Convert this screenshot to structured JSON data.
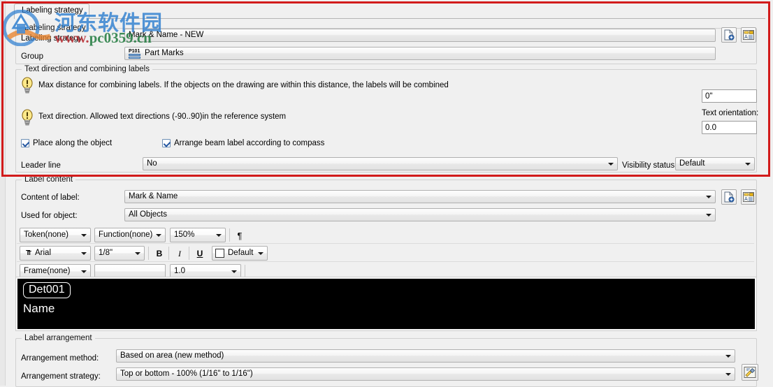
{
  "window": {
    "tab_label": "Labeling strategy",
    "accent_highlight": "#d21b1b"
  },
  "watermark": {
    "site_name": "河东软件园",
    "url_prefix": "www.",
    "url_rest": "pc0359.cn"
  },
  "strategy": {
    "group_label": "Labeling strategy",
    "name_label": "Labeling strategy",
    "name_value": "Mark & Name - NEW",
    "group_field_label": "Group",
    "group_value": "Part Marks",
    "group_icon_text": "P101",
    "btn_new_name": "new-label-button",
    "btn_edit_name": "edit-label-button"
  },
  "text_direction": {
    "group_label": "Text direction and combining labels",
    "hint_combine": "Max distance for combining labels. If the objects on the drawing are within this distance, the labels will be combined",
    "hint_direction": "Text direction. Allowed text directions (-90..90)in the reference system",
    "max_distance_value": "0\"",
    "text_orientation_label": "Text orientation:",
    "text_orientation_value": "0.0",
    "chk_place_along": "Place along the object",
    "chk_place_along_checked": true,
    "chk_arrange_beam": "Arrange beam label according to compass",
    "chk_arrange_beam_checked": true,
    "leader_line_label": "Leader line",
    "leader_line_value": "No",
    "visibility_label": "Visibility status",
    "visibility_value": "Default"
  },
  "label_content": {
    "group_label": "Label content",
    "content_label": "Content of label:",
    "content_value": "Mark & Name",
    "used_for_label": "Used for object:",
    "used_for_value": "All Objects",
    "token_value": "Token(none)",
    "function_value": "Function(none)",
    "scale_value": "150%",
    "pilcrow_glyph": "¶",
    "font_value": "Arial",
    "size_value": "1/8\"",
    "bold_label": "B",
    "italic_label": "I",
    "underline_label": "U",
    "color_value": "Default",
    "frame_value": "Frame(none)",
    "frame_extra_value": "",
    "line_width_value": "1.0"
  },
  "preview": {
    "mark_text": "Det001",
    "name_text": "Name"
  },
  "arrangement": {
    "group_label": "Label arrangement",
    "method_label": "Arrangement method:",
    "method_value": "Based on area (new method)",
    "strategy_label": "Arrangement strategy:",
    "strategy_value": "Top or bottom - 100% (1/16\" to 1/16\")",
    "tools_button_name": "arrangement-settings-button"
  }
}
